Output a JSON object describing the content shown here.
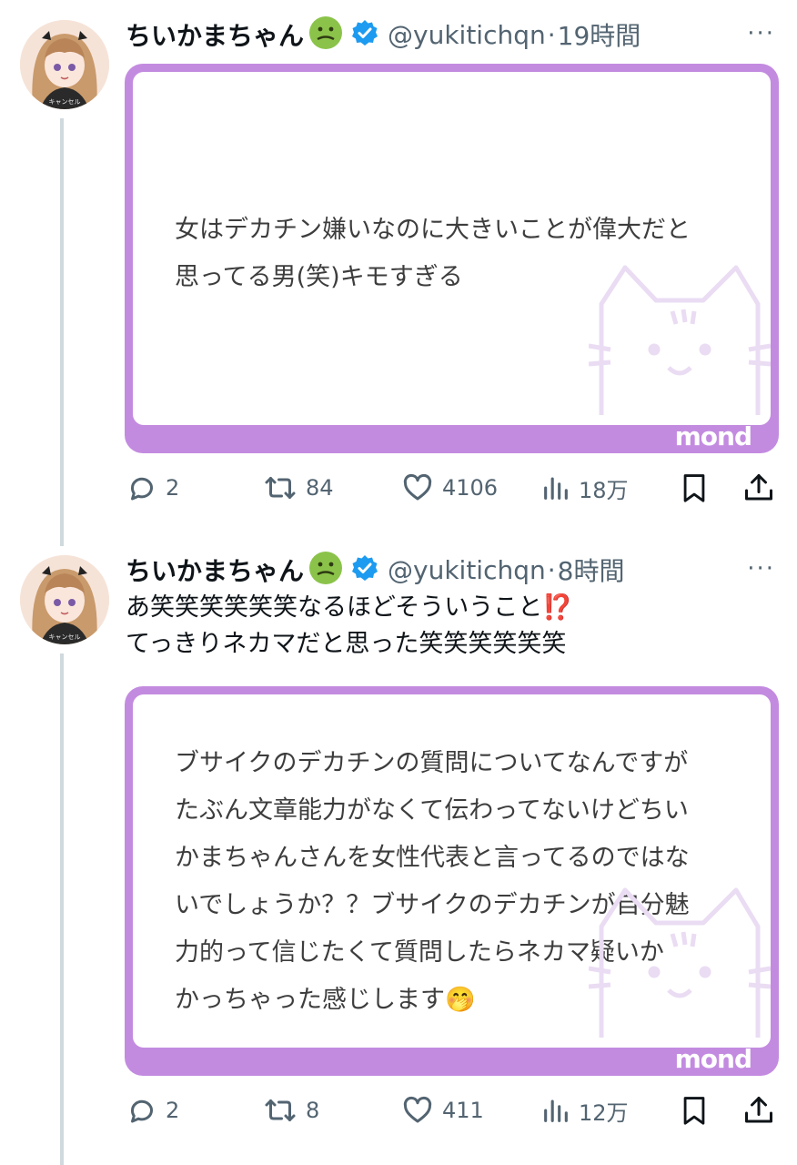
{
  "tweets": [
    {
      "display_name": "ちいかまちゃん",
      "handle": "@yukitichqn",
      "separator": "·",
      "time": "19時間",
      "more": "···",
      "body_lines": [],
      "card_lines": [
        "女はデカチン嫌いなのに大きいことが偉大だと",
        "思ってる男(笑)キモすぎる"
      ],
      "card_brand": "mond",
      "replies": "2",
      "retweets": "84",
      "likes": "4106",
      "views": "18万"
    },
    {
      "display_name": "ちいかまちゃん",
      "handle": "@yukitichqn",
      "separator": "·",
      "time": "8時間",
      "more": "···",
      "body_lines": [
        "あ笑笑笑笑笑笑なるほどそういうこと⁉️",
        "てっきりネカマだと思った笑笑笑笑笑笑"
      ],
      "card_lines": [
        "ブサイクのデカチンの質問についてなんですが",
        "たぶん文章能力がなくて伝わってないけどちい",
        "かまちゃんさんを女性代表と言ってるのではな",
        "いでしょうか？？ブサイクのデカチンが自分魅",
        "力的って信じたくて質問したらネカマ疑いか",
        "かっちゃった感じします🤭"
      ],
      "card_brand": "mond",
      "replies": "2",
      "retweets": "8",
      "likes": "411",
      "views": "12万"
    }
  ],
  "icons": {
    "name_emoji": "nauseated-face-icon",
    "verified": "verified-badge-icon",
    "reply": "reply-icon",
    "retweet": "retweet-icon",
    "like": "heart-icon",
    "views": "views-icon",
    "bookmark": "bookmark-icon",
    "share": "share-icon"
  },
  "colors": {
    "card_border": "#c38be0",
    "verified": "#1d9bf0",
    "secondary_text": "#536471",
    "thread_line": "#cfd9de"
  }
}
